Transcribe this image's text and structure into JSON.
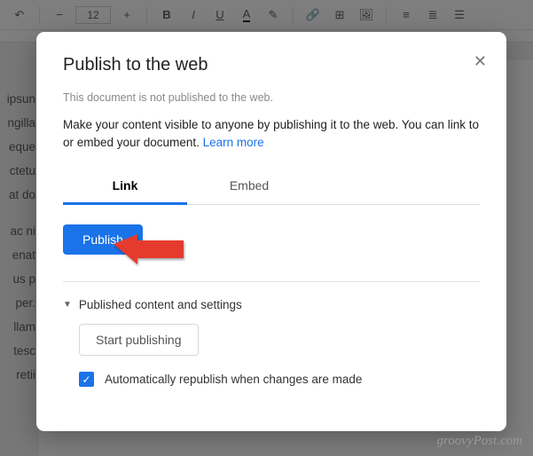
{
  "toolbar": {
    "font_size": "12"
  },
  "side_lines": [
    "ipsun",
    "ngilla",
    "eque",
    "ctetu",
    "at do",
    "",
    "ac ni",
    "enat",
    "us p",
    "per.",
    "llam",
    "tesc",
    "retii"
  ],
  "dialog": {
    "title": "Publish to the web",
    "status": "This document is not published to the web.",
    "description": "Make your content visible to anyone by publishing it to the web. You can link to or embed your document.",
    "learn_more": "Learn more",
    "tabs": {
      "link": "Link",
      "embed": "Embed"
    },
    "publish": "Publish",
    "collapse_label": "Published content and settings",
    "start_publishing": "Start publishing",
    "checkbox_label": "Automatically republish when changes are made"
  },
  "watermark": "groovyPost.com"
}
